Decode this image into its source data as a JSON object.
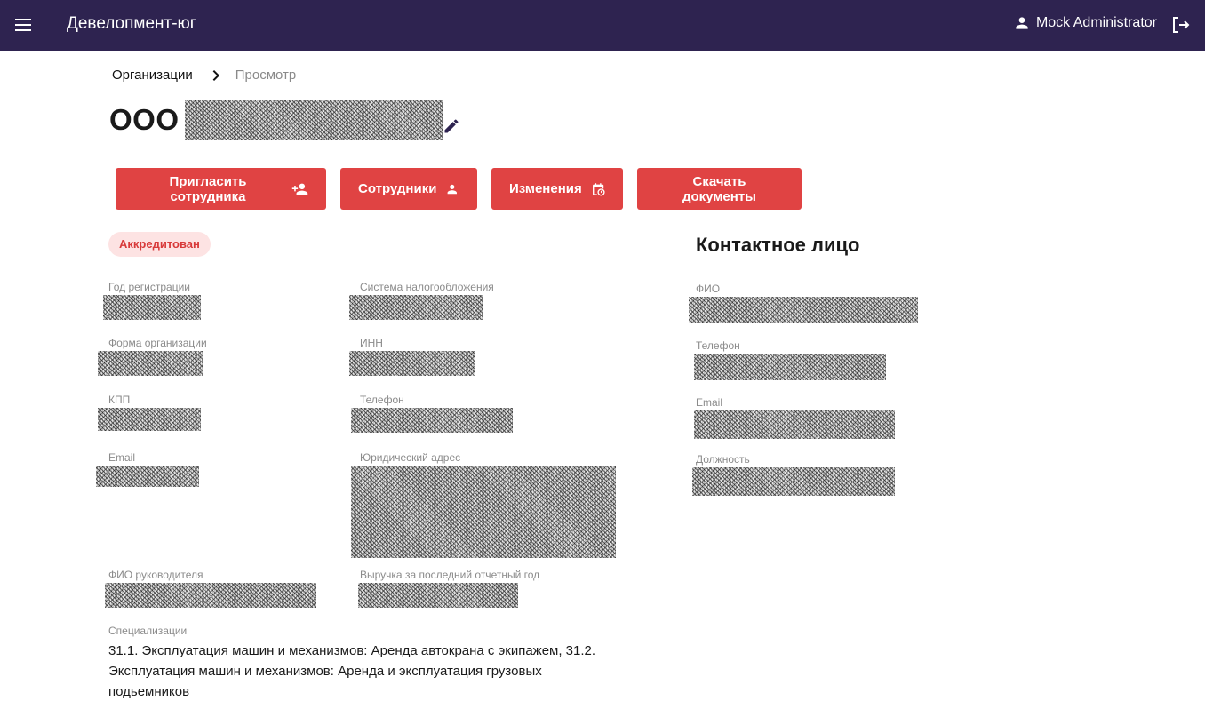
{
  "header": {
    "app_title": "Девелопмент-юг",
    "user_name": "Mock Administrator",
    "background_color": "#2e2350",
    "icons": {
      "menu": "hamburger-menu-icon",
      "user": "user-icon",
      "logout": "logout-icon"
    }
  },
  "breadcrumb": {
    "parent": "Организации",
    "current": "Просмотр"
  },
  "page": {
    "title": "ООО"
  },
  "actions": [
    {
      "label": "Пригласить сотрудника",
      "icon": "person-add-icon"
    },
    {
      "label": "Сотрудники",
      "icon": "person-icon"
    },
    {
      "label": "Изменения",
      "icon": "calendar-clock-icon"
    },
    {
      "label": "Скачать документы",
      "icon": ""
    }
  ],
  "accent_color": "#e04343",
  "status_badge": "Аккредитован",
  "organization": {
    "registration_year_label": "Год регистрации",
    "tax_system_label": "Система налогообложения",
    "org_form_label": "Форма организации",
    "inn_label": "ИНН",
    "kpp_label": "КПП",
    "phone_label": "Телефон",
    "email_label": "Email",
    "legal_address_label": "Юридический адрес",
    "director_label": "ФИО руководителя",
    "revenue_label": "Выручка за последний отчетный год",
    "specializations_label": "Специализации",
    "specializations_value": "31.1. Эксплуатация машин и механизмов: Аренда автокрана с экипажем, 31.2. Эксплуатация машин и механизмов: Аренда и эксплуатация грузовых подьемников"
  },
  "contact": {
    "title": "Контактное лицо",
    "fio_label": "ФИО",
    "phone_label": "Телефон",
    "email_label": "Email",
    "position_label": "Должность"
  }
}
